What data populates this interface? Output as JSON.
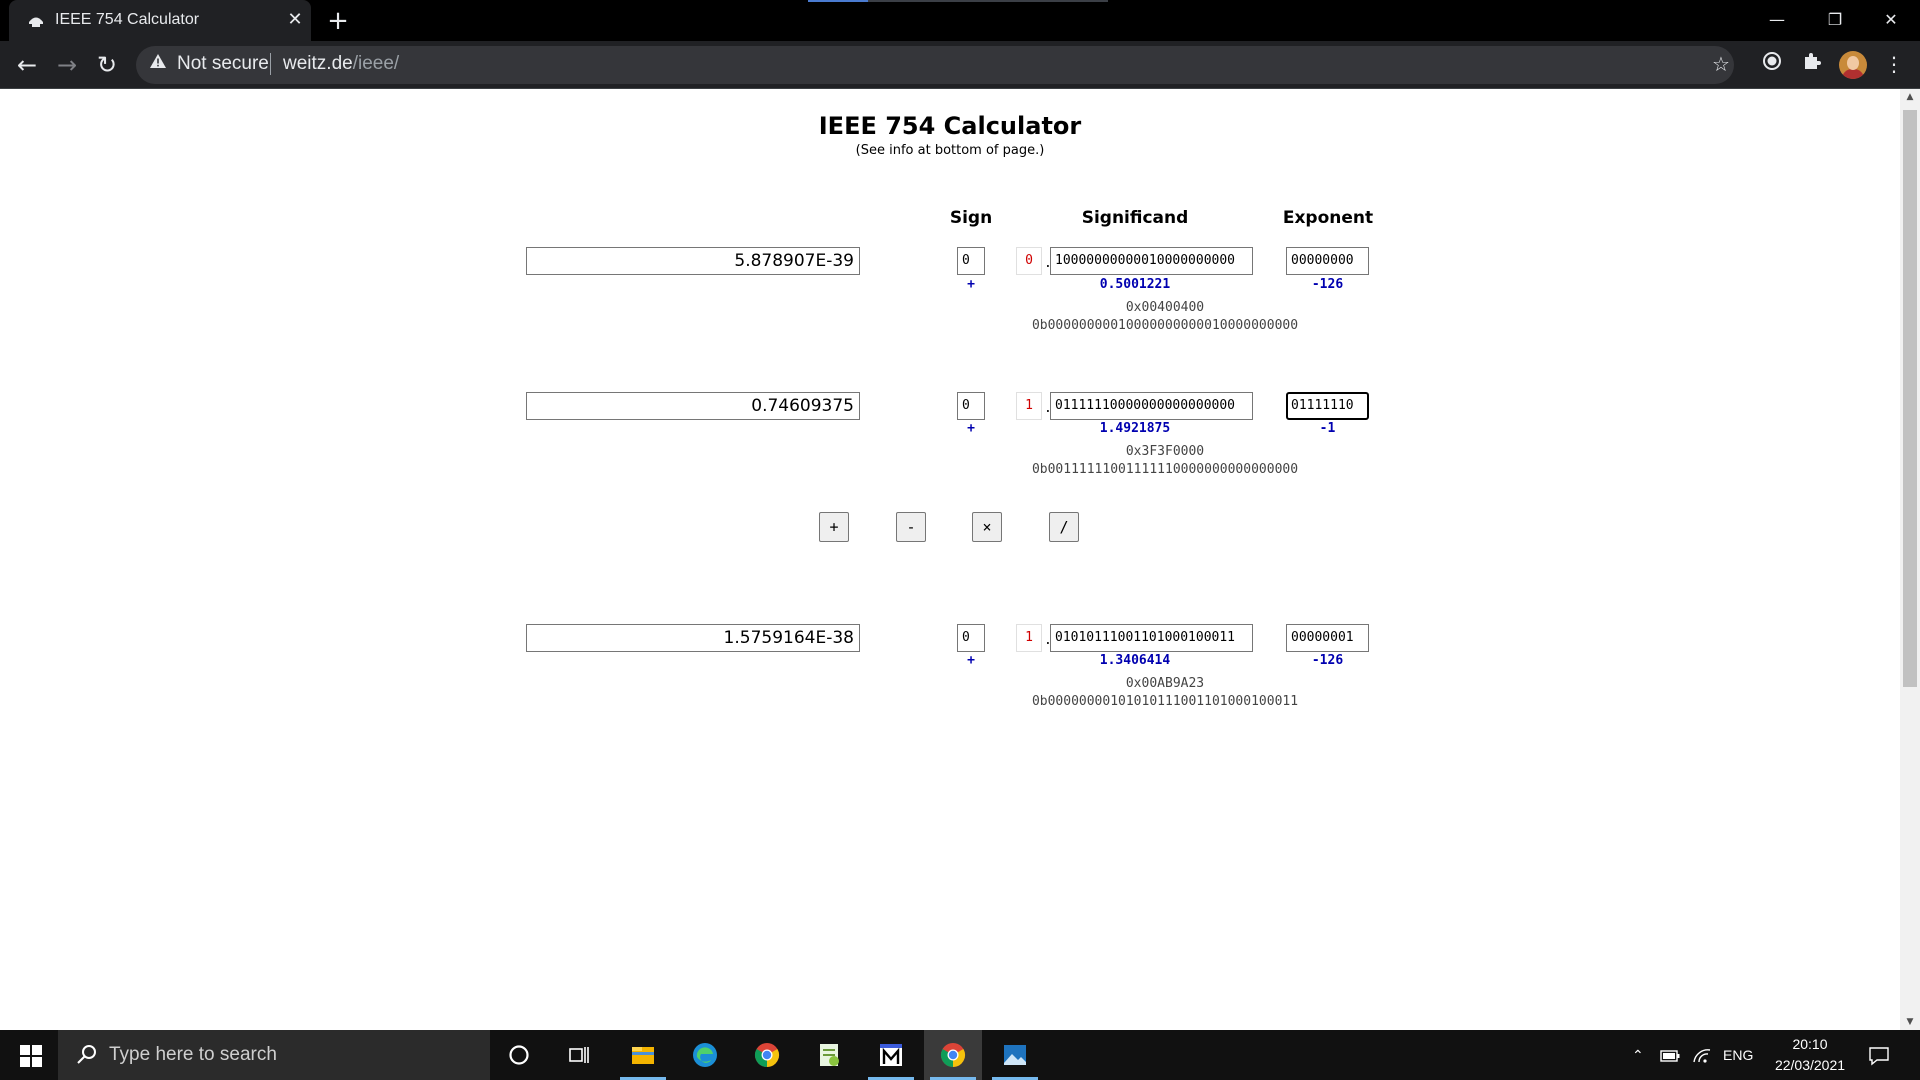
{
  "browser": {
    "tab_title": "IEEE 754 Calculator",
    "tab_close": "✕",
    "new_tab": "+",
    "minimize": "—",
    "restore": "❐",
    "close": "✕",
    "back": "←",
    "forward": "→",
    "reload": "↻",
    "security_label": "Not secure",
    "url_host": "weitz.de",
    "url_path": "/ieee/"
  },
  "page": {
    "title": "IEEE 754 Calculator",
    "subtitle": "(See info at bottom of page.)",
    "headers": {
      "sign": "Sign",
      "significand": "Significand",
      "exponent": "Exponent"
    }
  },
  "rows": [
    {
      "decimal": "5.878907E-39",
      "sign_bit": "0",
      "sign_symbol": "+",
      "hidden_bit": "0",
      "significand_bits": "10000000000010000000000",
      "significand_value": "0.5001221",
      "exponent_bits": "00000000",
      "exponent_value": "-126",
      "hex": "0x00400400",
      "binary": "0b00000000010000000000010000000000"
    },
    {
      "decimal": "0.74609375",
      "sign_bit": "0",
      "sign_symbol": "+",
      "hidden_bit": "1",
      "significand_bits": "01111110000000000000000",
      "significand_value": "1.4921875",
      "exponent_bits": "01111110",
      "exponent_value": "-1",
      "hex": "0x3F3F0000",
      "binary": "0b00111111001111110000000000000000"
    },
    {
      "decimal": "1.5759164E-38",
      "sign_bit": "0",
      "sign_symbol": "+",
      "hidden_bit": "1",
      "significand_bits": "01010111001101000100011",
      "significand_value": "1.3406414",
      "exponent_bits": "00000001",
      "exponent_value": "-126",
      "hex": "0x00AB9A23",
      "binary": "0b00000000101010111001101000100011"
    }
  ],
  "operations": {
    "add": "+",
    "subtract": "-",
    "multiply": "×",
    "divide": "/"
  },
  "taskbar": {
    "search_placeholder": "Type here to search",
    "language": "ENG",
    "time": "20:10",
    "date": "22/03/2021"
  },
  "icons": {
    "favicon": "calculator-icon",
    "star": "bookmark-star-icon",
    "extension": "puzzle-icon"
  }
}
